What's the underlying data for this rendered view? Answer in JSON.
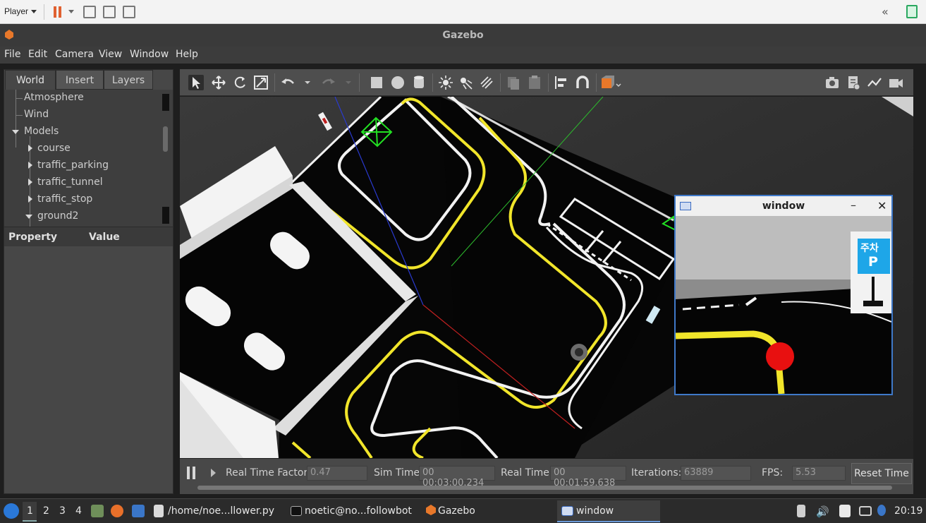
{
  "player_bar": {
    "label": "Player"
  },
  "window_title": "Gazebo",
  "menu": [
    "File",
    "Edit",
    "Camera",
    "View",
    "Window",
    "Help"
  ],
  "left_panel": {
    "tabs": [
      "World",
      "Insert",
      "Layers"
    ],
    "active_tab": "World",
    "tree": [
      {
        "label": "Atmosphere",
        "level": 0,
        "expander": "none"
      },
      {
        "label": "Wind",
        "level": 0,
        "expander": "none"
      },
      {
        "label": "Models",
        "level": 0,
        "expander": "expanded"
      },
      {
        "label": "course",
        "level": 1,
        "expander": "collapsed"
      },
      {
        "label": "traffic_parking",
        "level": 1,
        "expander": "collapsed"
      },
      {
        "label": "traffic_tunnel",
        "level": 1,
        "expander": "collapsed"
      },
      {
        "label": "traffic_stop",
        "level": 1,
        "expander": "collapsed"
      },
      {
        "label": "ground2",
        "level": 1,
        "expander": "expanded"
      }
    ],
    "property_header": {
      "property": "Property",
      "value": "Value"
    }
  },
  "toolbar_icons": [
    "select-arrow",
    "translate",
    "rotate",
    "scale",
    "undo",
    "redo",
    "box",
    "sphere",
    "cylinder",
    "point-light",
    "spot-light",
    "directional-light",
    "copy",
    "paste",
    "align",
    "snap",
    "view-angle",
    "screenshot",
    "log",
    "plot",
    "record-video"
  ],
  "bottom_bar": {
    "real_time_factor_label": "Real Time Factor:",
    "real_time_factor_value": "0.47",
    "sim_time_label": "Sim Time:",
    "sim_time_value": "00 00:03:00.234",
    "real_time_label": "Real Time:",
    "real_time_value": "00 00:01:59.638",
    "iterations_label": "Iterations:",
    "iterations_value": "63889",
    "fps_label": "FPS:",
    "fps_value": "5.53",
    "reset_button": "Reset Time"
  },
  "camera_window": {
    "title": "window",
    "sign_text_top": "주차",
    "sign_text_letter": "P"
  },
  "taskbar": {
    "workspaces": [
      "1",
      "2",
      "3",
      "4"
    ],
    "active_workspace": "1",
    "tasks": [
      {
        "label": "/home/noe...llower.py",
        "icon": "file-icon"
      },
      {
        "label": "noetic@no...followbot",
        "icon": "terminal-icon"
      },
      {
        "label": "Gazebo",
        "icon": "gazebo-icon"
      },
      {
        "label": "window",
        "icon": "window-icon",
        "active": true
      }
    ],
    "clock": "20:19"
  },
  "colors": {
    "lane_yellow": "#f1e52a",
    "lane_white": "#ffffff",
    "track_black": "#050505",
    "marker_red": "#e81010",
    "sign_blue": "#1ea6e8",
    "window_border": "#3f79c9",
    "gazebo_orange": "#e8782a"
  }
}
